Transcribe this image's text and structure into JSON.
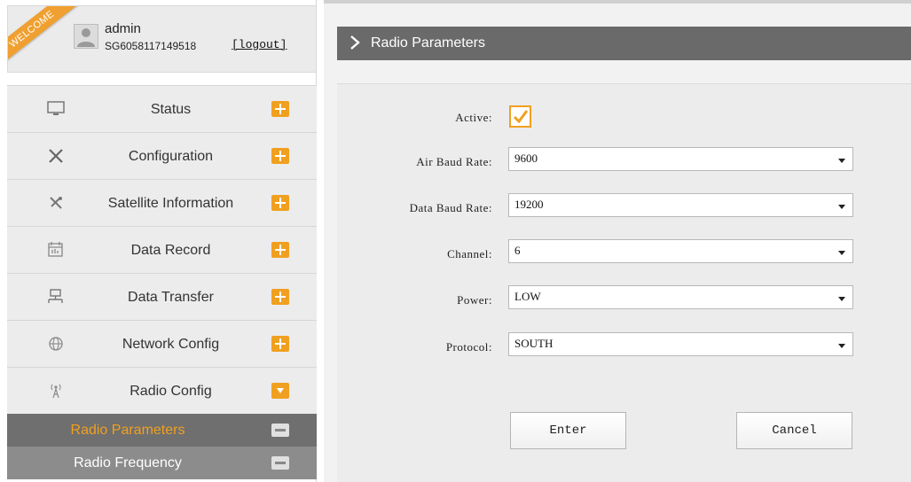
{
  "user": {
    "welcome_ribbon": "WELCOME",
    "name": "admin",
    "serial": "SG6058117149518",
    "logout_label": "[logout]"
  },
  "menu": {
    "items": [
      {
        "label": "Status",
        "icon": "monitor-icon",
        "state": "collapsed"
      },
      {
        "label": "Configuration",
        "icon": "tools-icon",
        "state": "collapsed"
      },
      {
        "label": "Satellite Information",
        "icon": "satellite-icon",
        "state": "collapsed"
      },
      {
        "label": "Data Record",
        "icon": "calendar-icon",
        "state": "collapsed"
      },
      {
        "label": "Data Transfer",
        "icon": "network-icon",
        "state": "collapsed"
      },
      {
        "label": "Network Config",
        "icon": "globe-icon",
        "state": "collapsed"
      },
      {
        "label": "Radio Config",
        "icon": "radio-icon",
        "state": "expanded"
      }
    ],
    "sub_items": [
      {
        "label": "Radio Parameters",
        "active": true
      },
      {
        "label": "Radio Frequency",
        "active": false
      }
    ]
  },
  "page": {
    "title": "Radio Parameters"
  },
  "form": {
    "active_label": "Active:",
    "active_checked": true,
    "fields": [
      {
        "label": "Air Baud Rate:",
        "value": "9600"
      },
      {
        "label": "Data Baud Rate:",
        "value": "19200"
      },
      {
        "label": "Channel:",
        "value": "6"
      },
      {
        "label": "Power:",
        "value": "LOW"
      },
      {
        "label": "Protocol:",
        "value": "SOUTH"
      }
    ],
    "enter_label": "Enter",
    "cancel_label": "Cancel"
  },
  "colors": {
    "accent": "#f0a020",
    "title_bar": "#6a6a6a",
    "submenu_active_bg": "#6f6f6f",
    "submenu_bg": "#8c8c8c"
  }
}
